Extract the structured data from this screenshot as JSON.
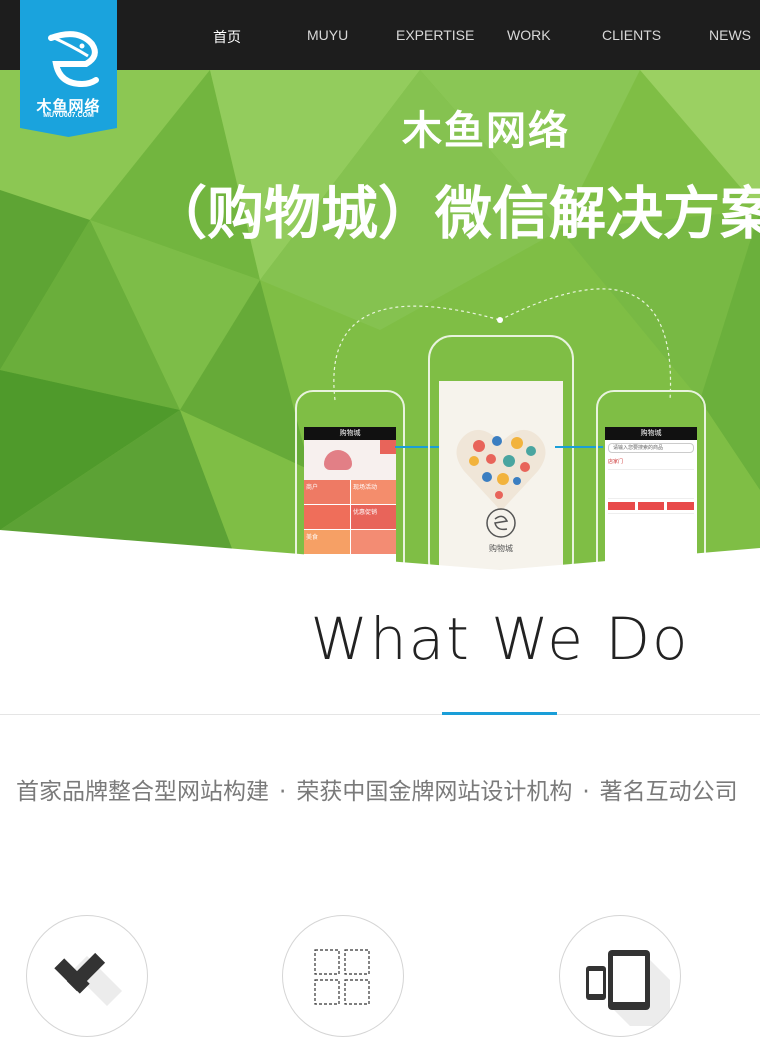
{
  "logo": {
    "name": "木鱼网络",
    "domain": "MUYU007.COM"
  },
  "nav": {
    "items": [
      {
        "label": "首页",
        "active": true
      },
      {
        "label": "MUYU"
      },
      {
        "label": "EXPERTISE"
      },
      {
        "label": "WORK"
      },
      {
        "label": "CLIENTS"
      },
      {
        "label": "NEWS"
      }
    ]
  },
  "banner": {
    "title": "木鱼网络",
    "subtitle": "（购物城）微信解决方案",
    "phone_left": {
      "header": "购物城",
      "tiles": [
        "商户",
        "现场活动",
        "优惠促销",
        "美食"
      ]
    },
    "phone_center": {
      "caption": "购物城"
    },
    "phone_right": {
      "header": "购物城",
      "search": "请输入您要搜索的商品",
      "section": "店家门"
    }
  },
  "what_we_do": {
    "title": "What We Do",
    "taglines": [
      "首家品牌整合型网站构建",
      "荣获中国金牌网站设计机构",
      "著名互动公司"
    ],
    "separator": "·"
  },
  "services": [
    {
      "icon": "pencil-ruler-icon"
    },
    {
      "icon": "layout-grid-icon"
    },
    {
      "icon": "devices-icon"
    }
  ],
  "colors": {
    "topbar": "#1d1d1d",
    "logo": "#1aa3dd",
    "banner_green": "#7fbe45",
    "accent_blue": "#1a9ed8",
    "tile_red": "#e8645a"
  }
}
